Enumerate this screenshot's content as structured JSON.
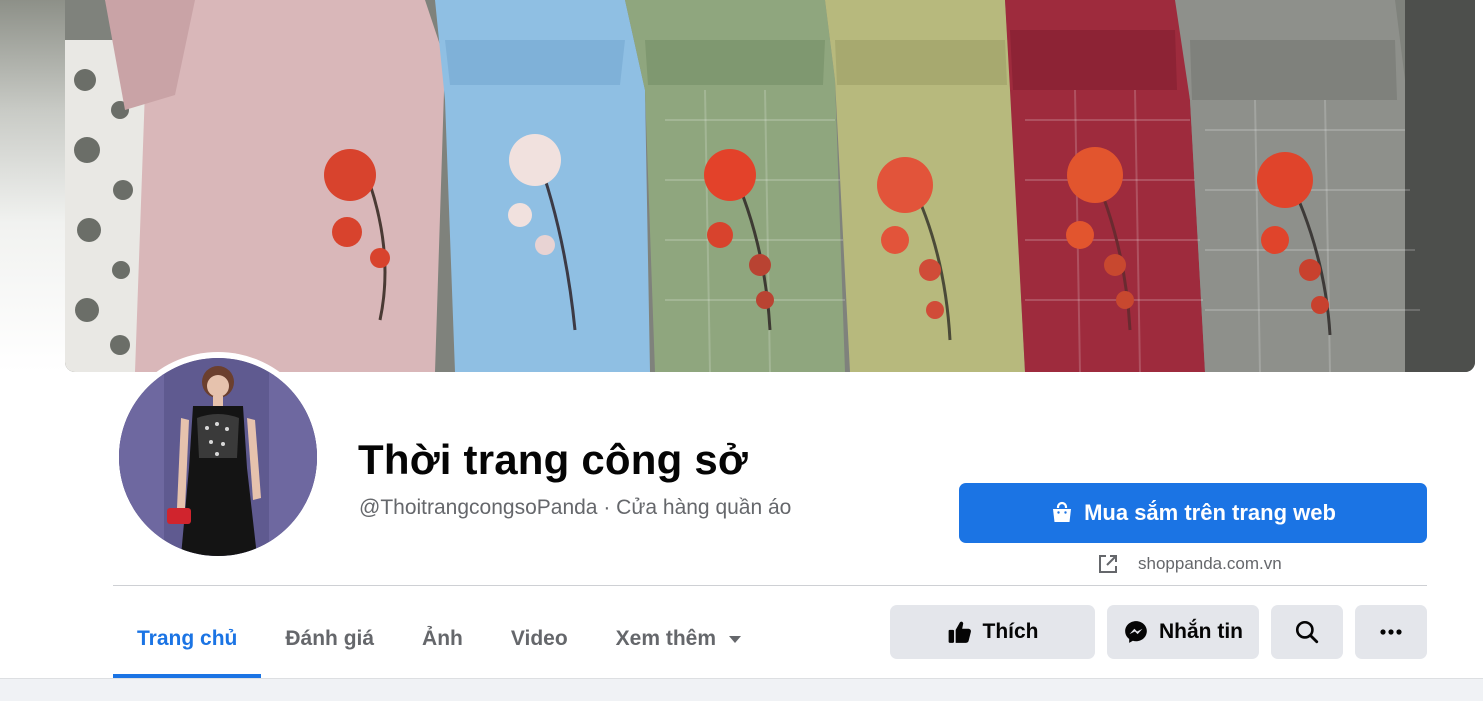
{
  "cover": {
    "icon": "dress-collection-photo"
  },
  "profile": {
    "avatar_icon": "dress-model-photo",
    "name": "Thời trang công sở",
    "handle": "@ThoitrangcongsoPanda",
    "separator": " · ",
    "category": "Cửa hàng quần áo"
  },
  "shop": {
    "button_label": "Mua sắm trên trang web",
    "button_icon": "shopping-bag-icon",
    "link_icon": "external-link-icon",
    "website": "shoppanda.com.vn"
  },
  "tabs": [
    {
      "label": "Trang chủ",
      "active": true
    },
    {
      "label": "Đánh giá"
    },
    {
      "label": "Ảnh"
    },
    {
      "label": "Video"
    },
    {
      "label": "Xem thêm",
      "icon": "caret-down-icon"
    }
  ],
  "actions": {
    "like_label": "Thích",
    "message_label": "Nhắn tin",
    "search_icon": "search-icon",
    "more_icon": "more-icon"
  },
  "colors": {
    "accent": "#1b74e4",
    "secondary_button": "#e4e6eb",
    "muted_text": "#65676b"
  }
}
